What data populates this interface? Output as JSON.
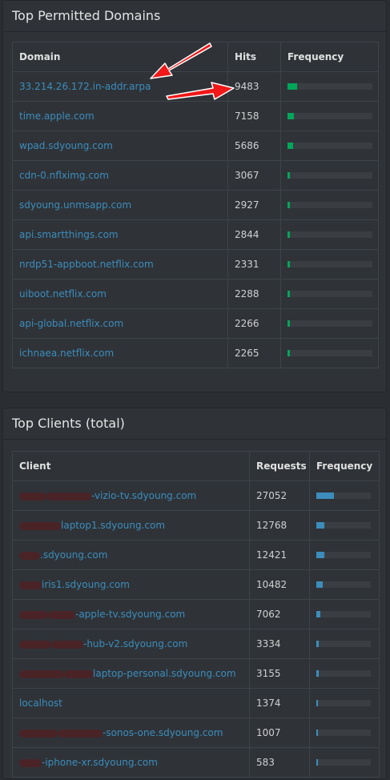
{
  "domains": {
    "title": "Top Permitted Domains",
    "columns": [
      "Domain",
      "Hits",
      "Frequency"
    ],
    "rows": [
      {
        "name": "33.214.26.172.in-addr.arpa",
        "hits": "9483",
        "freq": 0.11
      },
      {
        "name": "time.apple.com",
        "hits": "7158",
        "freq": 0.08
      },
      {
        "name": "wpad.sdyoung.com",
        "hits": "5686",
        "freq": 0.065
      },
      {
        "name": "cdn-0.nflximg.com",
        "hits": "3067",
        "freq": 0.03
      },
      {
        "name": "sdyoung.unmsapp.com",
        "hits": "2927",
        "freq": 0.03
      },
      {
        "name": "api.smartthings.com",
        "hits": "2844",
        "freq": 0.03
      },
      {
        "name": "nrdp51-appboot.netflix.com",
        "hits": "2331",
        "freq": 0.025
      },
      {
        "name": "uiboot.netflix.com",
        "hits": "2288",
        "freq": 0.025
      },
      {
        "name": "api-global.netflix.com",
        "hits": "2266",
        "freq": 0.025
      },
      {
        "name": "ichnaea.netflix.com",
        "hits": "2265",
        "freq": 0.025
      }
    ]
  },
  "clients": {
    "title": "Top Clients (total)",
    "columns": [
      "Client",
      "Requests",
      "Frequency"
    ],
    "rows": [
      {
        "name": "-vizio-tv.sdyoung.com",
        "requests": "27052",
        "freq": 0.32
      },
      {
        "name": "laptop1.sdyoung.com",
        "requests": "12768",
        "freq": 0.15
      },
      {
        "name": ".sdyoung.com",
        "requests": "12421",
        "freq": 0.15
      },
      {
        "name": "iris1.sdyoung.com",
        "requests": "10482",
        "freq": 0.12
      },
      {
        "name": "-apple-tv.sdyoung.com",
        "requests": "7062",
        "freq": 0.08
      },
      {
        "name": "-hub-v2.sdyoung.com",
        "requests": "3334",
        "freq": 0.04
      },
      {
        "name": "laptop-personal.sdyoung.com",
        "requests": "3155",
        "freq": 0.04
      },
      {
        "name": "localhost",
        "requests": "1374",
        "freq": 0.02
      },
      {
        "name": "-sonos-one.sdyoung.com",
        "requests": "1007",
        "freq": 0.015
      },
      {
        "name": "-iphone-xr.sdyoung.com",
        "requests": "583",
        "freq": 0.01
      }
    ]
  },
  "colors": {
    "accent": "#3c8dbc",
    "domain_bar": "#00a65a",
    "client_bar": "#3c8dbc",
    "annotation": "#ff0000"
  }
}
